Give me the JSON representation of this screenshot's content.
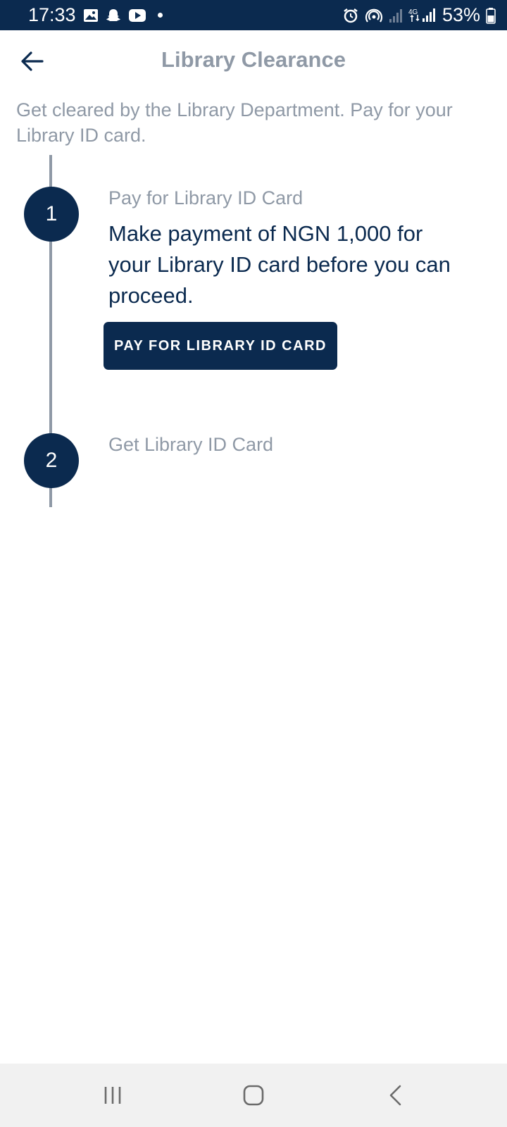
{
  "status_bar": {
    "time": "17:33",
    "battery": "53%",
    "network": "4G",
    "icons": [
      "gallery-icon",
      "snapchat-icon",
      "youtube-icon",
      "dot-icon",
      "alarm-icon",
      "hotspot-icon",
      "signal-icon",
      "signal-4g-icon",
      "battery-icon"
    ]
  },
  "header": {
    "title": "Library Clearance",
    "back_icon": "arrow-left-icon"
  },
  "subtitle": "Get cleared by the Library Department. Pay for your Library ID card.",
  "steps": [
    {
      "number": "1",
      "title": "Pay for Library ID Card",
      "description": "Make payment of NGN 1,000 for your Library ID card before you can proceed.",
      "button_label": "PAY FOR LIBRARY ID CARD"
    },
    {
      "number": "2",
      "title": "Get Library ID Card"
    }
  ],
  "nav_bar": {
    "icons": [
      "recent-apps-icon",
      "home-icon",
      "back-icon"
    ]
  },
  "colors": {
    "primary": "#0b2a4f",
    "muted": "#8f99a6",
    "nav_bg": "#f1f1f1"
  }
}
